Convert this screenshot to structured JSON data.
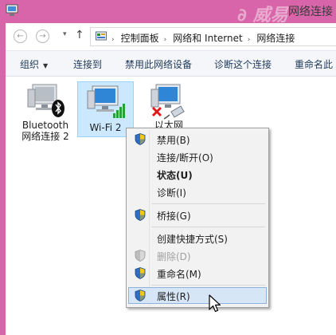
{
  "window": {
    "title": "网络连接",
    "watermark": "∂ 威易"
  },
  "address": {
    "crumbs": [
      "控制面板",
      "网络和 Internet",
      "网络连接"
    ]
  },
  "toolbar": {
    "organize": "组织",
    "connect_to": "连接到",
    "disable_device": "禁用此网络设备",
    "diagnose": "诊断这个连接",
    "rename": "重命名此"
  },
  "items": [
    {
      "name_line1": "Bluetooth",
      "name_line2": "网络连接 2"
    },
    {
      "name_line1": "Wi-Fi 2"
    },
    {
      "name_line1": "以太网"
    }
  ],
  "context_menu": {
    "items": [
      {
        "label": "禁用(B)",
        "shield": true
      },
      {
        "label": "连接/断开(O)",
        "shield": false
      },
      {
        "label": "状态(U)",
        "shield": false,
        "bold": true
      },
      {
        "label": "诊断(I)",
        "shield": false
      },
      {
        "label": "桥接(G)",
        "shield": true
      },
      {
        "label": "创建快捷方式(S)",
        "shield": false
      },
      {
        "label": "删除(D)",
        "shield": true,
        "disabled": true
      },
      {
        "label": "重命名(M)",
        "shield": true
      },
      {
        "label": "属性(R)",
        "shield": true,
        "hover": true
      }
    ]
  },
  "colors": {
    "frame": "#d865a9",
    "selection": "#cce8ff",
    "menu_hover": "#d6e6f6"
  }
}
